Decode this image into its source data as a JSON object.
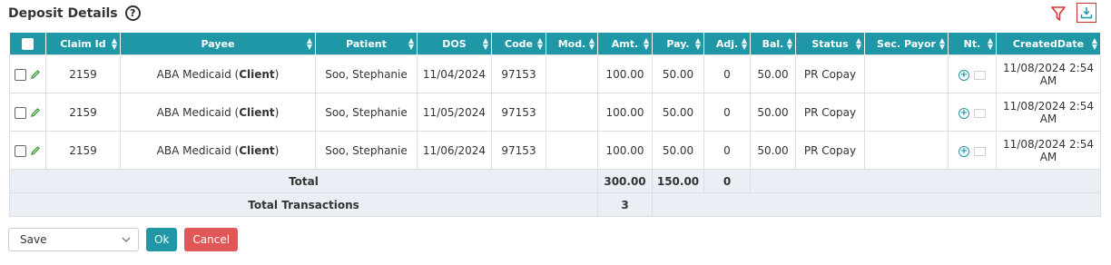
{
  "header": {
    "title": "Deposit Details",
    "help_icon": "?"
  },
  "toolbar": {
    "filter_icon": "filter-icon",
    "download_icon": "download-icon"
  },
  "table": {
    "columns": [
      "",
      "Claim Id",
      "Payee",
      "Patient",
      "DOS",
      "Code",
      "Mod.",
      "Amt.",
      "Pay.",
      "Adj.",
      "Bal.",
      "Status",
      "Sec. Payor",
      "Nt.",
      "CreatedDate"
    ],
    "rows": [
      {
        "claim_id": "2159",
        "payee_name": "ABA Medicaid",
        "payee_tag": "Client",
        "patient": "Soo, Stephanie",
        "dos": "11/04/2024",
        "code": "97153",
        "mod": "",
        "amt": "100.00",
        "pay": "50.00",
        "adj": "0",
        "bal": "50.00",
        "status": "PR Copay",
        "sec_payor": "",
        "created": "11/08/2024 2:54 AM"
      },
      {
        "claim_id": "2159",
        "payee_name": "ABA Medicaid",
        "payee_tag": "Client",
        "patient": "Soo, Stephanie",
        "dos": "11/05/2024",
        "code": "97153",
        "mod": "",
        "amt": "100.00",
        "pay": "50.00",
        "adj": "0",
        "bal": "50.00",
        "status": "PR Copay",
        "sec_payor": "",
        "created": "11/08/2024 2:54 AM"
      },
      {
        "claim_id": "2159",
        "payee_name": "ABA Medicaid",
        "payee_tag": "Client",
        "patient": "Soo, Stephanie",
        "dos": "11/06/2024",
        "code": "97153",
        "mod": "",
        "amt": "100.00",
        "pay": "50.00",
        "adj": "0",
        "bal": "50.00",
        "status": "PR Copay",
        "sec_payor": "",
        "created": "11/08/2024 2:54 AM"
      }
    ],
    "total": {
      "label": "Total",
      "amt": "300.00",
      "pay": "150.00",
      "adj": "0"
    },
    "total_transactions": {
      "label": "Total Transactions",
      "value": "3"
    }
  },
  "actions": {
    "select_value": "Save",
    "ok_label": "Ok",
    "cancel_label": "Cancel"
  },
  "colors": {
    "header_bg": "#1f97a6",
    "cancel_bg": "#e15656",
    "total_bg": "#e9eff5"
  }
}
